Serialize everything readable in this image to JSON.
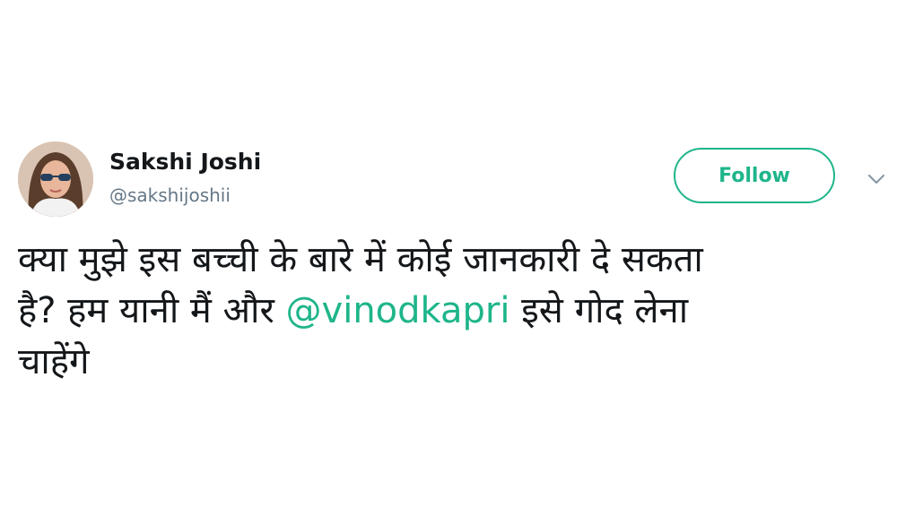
{
  "tweet": {
    "author": {
      "name": "Sakshi Joshi",
      "handle": "@sakshijoshii"
    },
    "follow_label": "Follow",
    "text": {
      "line1": "क्या मुझे इस बच्ची के बारे में कोई जानकारी दे सकता",
      "line2_before": "है? हम यानी मैं और ",
      "mention": "@vinodkapri",
      "line2_after": " इसे गोद लेना",
      "line3": "चाहेंगे"
    }
  },
  "colors": {
    "accent": "#1eb58a",
    "text": "#14171a",
    "muted": "#657786",
    "chevron": "#8899a6"
  },
  "icons": {
    "menu": "chevron-down-icon"
  }
}
